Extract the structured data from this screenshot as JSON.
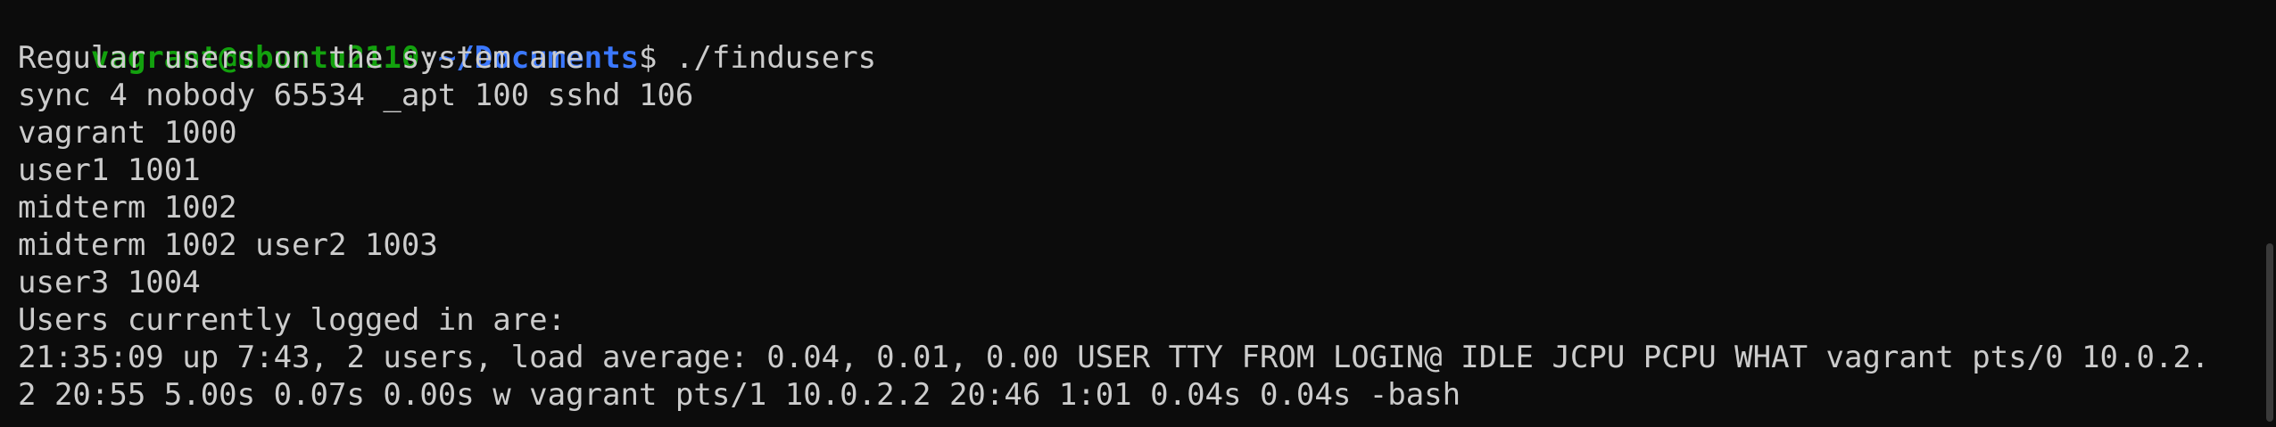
{
  "prompt": {
    "user_host": "vagrant@ubuntu2110",
    "separator": ":",
    "path": "~/Documents",
    "symbol": "$ ",
    "command": "./findusers"
  },
  "output": [
    "Regular users on the system are",
    "sync 4 nobody 65534 _apt 100 sshd 106",
    "vagrant 1000",
    "user1 1001",
    "midterm 1002",
    "midterm 1002 user2 1003",
    "user3 1004",
    "Users currently logged in are:",
    "21:35:09 up 7:43, 2 users, load average: 0.04, 0.01, 0.00 USER TTY FROM LOGIN@ IDLE JCPU PCPU WHAT vagrant pts/0 10.0.2.",
    "2 20:55 5.00s 0.07s 0.00s w vagrant pts/1 10.0.2.2 20:46 1:01 0.04s 0.04s -bash"
  ],
  "colors": {
    "background": "#0c0c0c",
    "text": "#cccccc",
    "prompt_user": "#13a10e",
    "prompt_path": "#3b78ff"
  }
}
